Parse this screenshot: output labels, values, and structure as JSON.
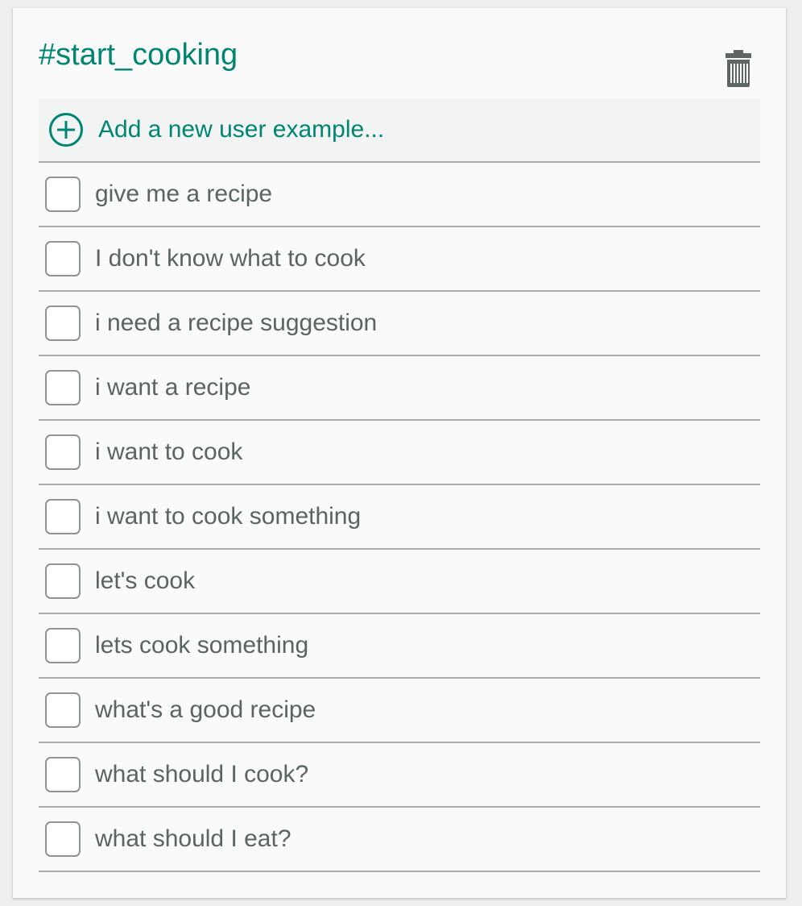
{
  "intent": {
    "title": "#start_cooking"
  },
  "icons": {
    "delete": "trash-icon",
    "add": "plus-circle-icon"
  },
  "colors": {
    "accent": "#008571",
    "text": "#5a6463",
    "divider": "#a8b0ae"
  },
  "add_example": {
    "label": "Add a new user example..."
  },
  "examples": [
    "give me a recipe",
    "I don't know what to cook",
    "i need a recipe suggestion",
    "i want a recipe",
    "i want to cook",
    "i want to cook something",
    "let's cook",
    "lets cook something",
    "what's a good recipe",
    "what should I cook?",
    "what should I eat?"
  ]
}
